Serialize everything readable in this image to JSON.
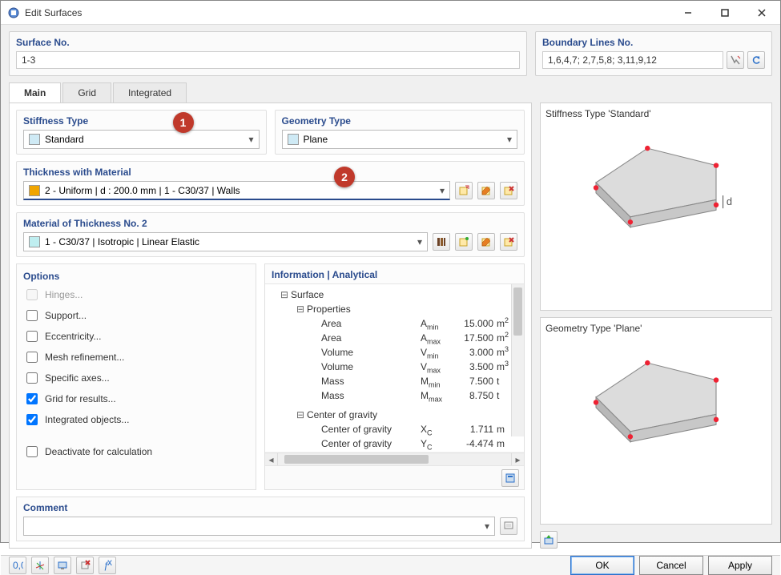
{
  "window": {
    "title": "Edit Surfaces"
  },
  "surface_no": {
    "label": "Surface No.",
    "value": "1-3"
  },
  "boundary": {
    "label": "Boundary Lines No.",
    "value": "1,6,4,7; 2,7,5,8; 3,11,9,12"
  },
  "tabs": {
    "main": "Main",
    "grid": "Grid",
    "integrated": "Integrated"
  },
  "stiffness": {
    "label": "Stiffness Type",
    "value": "Standard"
  },
  "geometry": {
    "label": "Geometry Type",
    "value": "Plane"
  },
  "thickness": {
    "label": "Thickness with Material",
    "value": "2 - Uniform | d : 200.0 mm | 1 - C30/37 | Walls"
  },
  "material": {
    "label": "Material of Thickness No. 2",
    "value": "1 - C30/37 | Isotropic | Linear Elastic"
  },
  "options": {
    "label": "Options",
    "hinges": "Hinges...",
    "support": "Support...",
    "eccentricity": "Eccentricity...",
    "mesh": "Mesh refinement...",
    "axes": "Specific axes...",
    "grid_results": "Grid for results...",
    "integrated": "Integrated objects...",
    "deactivate": "Deactivate for calculation"
  },
  "info": {
    "header": "Information | Analytical",
    "surface": "Surface",
    "properties": "Properties",
    "rows": [
      {
        "label": "Area",
        "sym": "A",
        "sub": "min",
        "val": "15.000",
        "unit": "m",
        "sup": "2"
      },
      {
        "label": "Area",
        "sym": "A",
        "sub": "max",
        "val": "17.500",
        "unit": "m",
        "sup": "2"
      },
      {
        "label": "Volume",
        "sym": "V",
        "sub": "min",
        "val": "3.000",
        "unit": "m",
        "sup": "3"
      },
      {
        "label": "Volume",
        "sym": "V",
        "sub": "max",
        "val": "3.500",
        "unit": "m",
        "sup": "3"
      },
      {
        "label": "Mass",
        "sym": "M",
        "sub": "min",
        "val": "7.500",
        "unit": "t",
        "sup": ""
      },
      {
        "label": "Mass",
        "sym": "M",
        "sub": "max",
        "val": "8.750",
        "unit": "t",
        "sup": ""
      }
    ],
    "cog": "Center of gravity",
    "cog_rows": [
      {
        "label": "Center of gravity",
        "sym": "X",
        "sub": "C",
        "val": "1.711",
        "unit": "m"
      },
      {
        "label": "Center of gravity",
        "sym": "Y",
        "sub": "C",
        "val": "-4.474",
        "unit": "m"
      }
    ]
  },
  "preview": {
    "stiffness_label": "Stiffness Type 'Standard'",
    "geometry_label": "Geometry Type 'Plane'"
  },
  "comment": {
    "label": "Comment"
  },
  "buttons": {
    "ok": "OK",
    "cancel": "Cancel",
    "apply": "Apply"
  },
  "badges": {
    "one": "1",
    "two": "2"
  }
}
